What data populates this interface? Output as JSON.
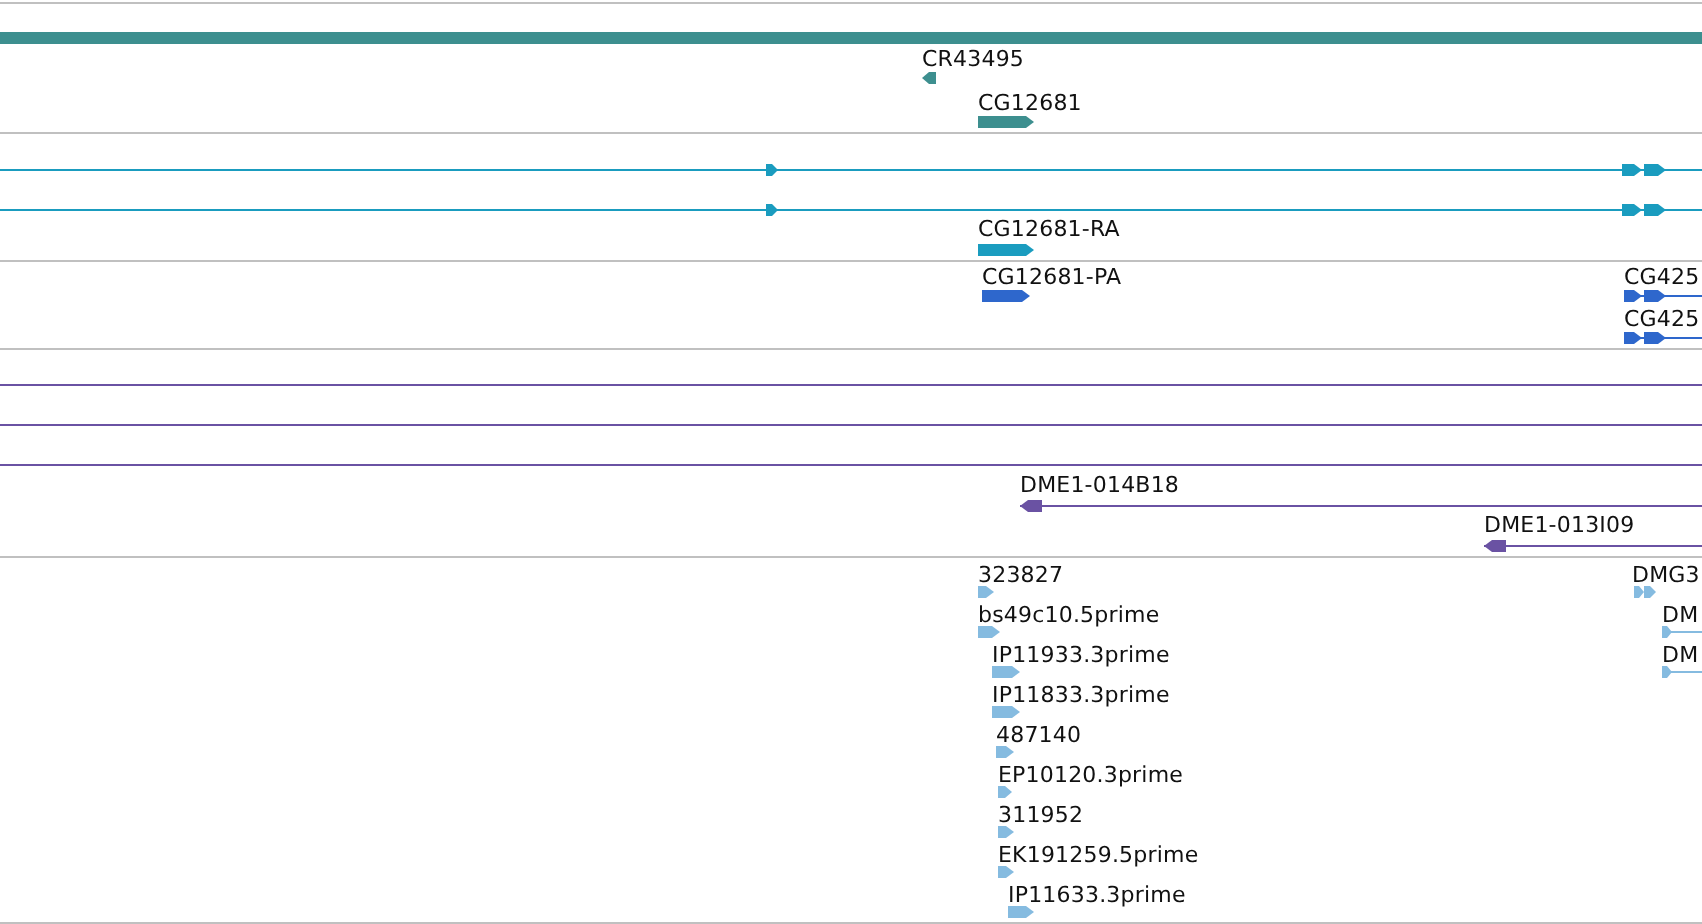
{
  "tracks": [
    {
      "color": "#3d8f8f",
      "features": [
        {
          "label": "CR43495",
          "reverse": true
        },
        {
          "label": "CG12681",
          "reverse": false
        }
      ]
    },
    {
      "color": "#1a9cbf",
      "features": [
        {
          "reverse": false
        },
        {
          "reverse": false
        },
        {
          "label": "CG12681-RA",
          "reverse": false
        }
      ]
    },
    {
      "color": "#2e67cc",
      "features": [
        {
          "label": "CG12681-PA",
          "reverse": false
        },
        {
          "label": "CG425",
          "reverse": false
        },
        {
          "label": "CG425",
          "reverse": false
        }
      ]
    },
    {
      "color": "#6a52a3",
      "features": [
        {
          "label": "DME1-014B18",
          "reverse": true
        },
        {
          "label": "DME1-013I09",
          "reverse": true
        }
      ]
    },
    {
      "color": "#85bbe0",
      "features": [
        {
          "label": "323827",
          "reverse": false
        },
        {
          "label": "bs49c10.5prime",
          "reverse": false
        },
        {
          "label": "IP11933.3prime",
          "reverse": false
        },
        {
          "label": "IP11833.3prime",
          "reverse": false
        },
        {
          "label": "487140",
          "reverse": false
        },
        {
          "label": "EP10120.3prime",
          "reverse": false
        },
        {
          "label": "311952",
          "reverse": false
        },
        {
          "label": "EK191259.5prime",
          "reverse": false
        },
        {
          "label": "IP11633.3prime",
          "reverse": false
        },
        {
          "label": "DMG3",
          "reverse": false
        },
        {
          "label": "DM",
          "reverse": false
        },
        {
          "label": "DM",
          "reverse": false
        }
      ]
    }
  ]
}
